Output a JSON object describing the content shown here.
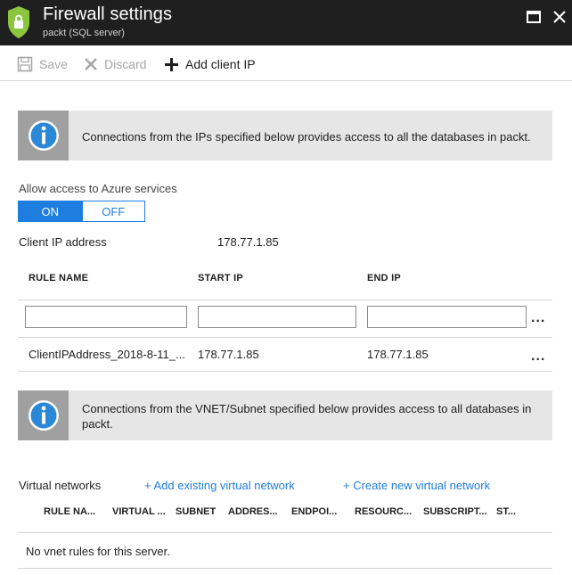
{
  "window": {
    "title": "Firewall settings",
    "subtitle": "packt (SQL server)"
  },
  "toolbar": {
    "save_label": "Save",
    "discard_label": "Discard",
    "add_client_ip_label": "Add client IP"
  },
  "info_banner_1": {
    "text": "Connections from the IPs specified below provides access to all the databases in packt."
  },
  "azure_access": {
    "label": "Allow access to Azure services",
    "on_label": "ON",
    "off_label": "OFF",
    "selected": "ON"
  },
  "client_ip": {
    "label": "Client IP address",
    "value": "178.77.1.85"
  },
  "rules_table": {
    "headers": [
      "RULE NAME",
      "START IP",
      "END IP"
    ],
    "new_row": {
      "rule_name": "",
      "start_ip": "",
      "end_ip": ""
    },
    "rows": [
      {
        "rule_name": "ClientIPAddress_2018-8-11_...",
        "start_ip": "178.77.1.85",
        "end_ip": "178.77.1.85"
      }
    ],
    "more_symbol": "..."
  },
  "info_banner_2": {
    "text": "Connections from the VNET/Subnet specified below provides access to all databases in packt."
  },
  "virtual_networks": {
    "label": "Virtual networks",
    "add_existing_link": "+ Add existing virtual network",
    "create_new_link": "+ Create new virtual network",
    "headers": [
      "RULE NA...",
      "VIRTUAL ...",
      "SUBNET",
      "ADDRES...",
      "ENDPOI...",
      "RESOURC...",
      "SUBSCRIPT...",
      "ST..."
    ],
    "empty_message": "No vnet rules for this server."
  },
  "colors": {
    "header_bg": "#1f1f1f",
    "accent": "#1e7ee0",
    "shield": "#8cc63f",
    "banner_bg": "#e6e6e6",
    "info_icon": "#2b88d8"
  }
}
